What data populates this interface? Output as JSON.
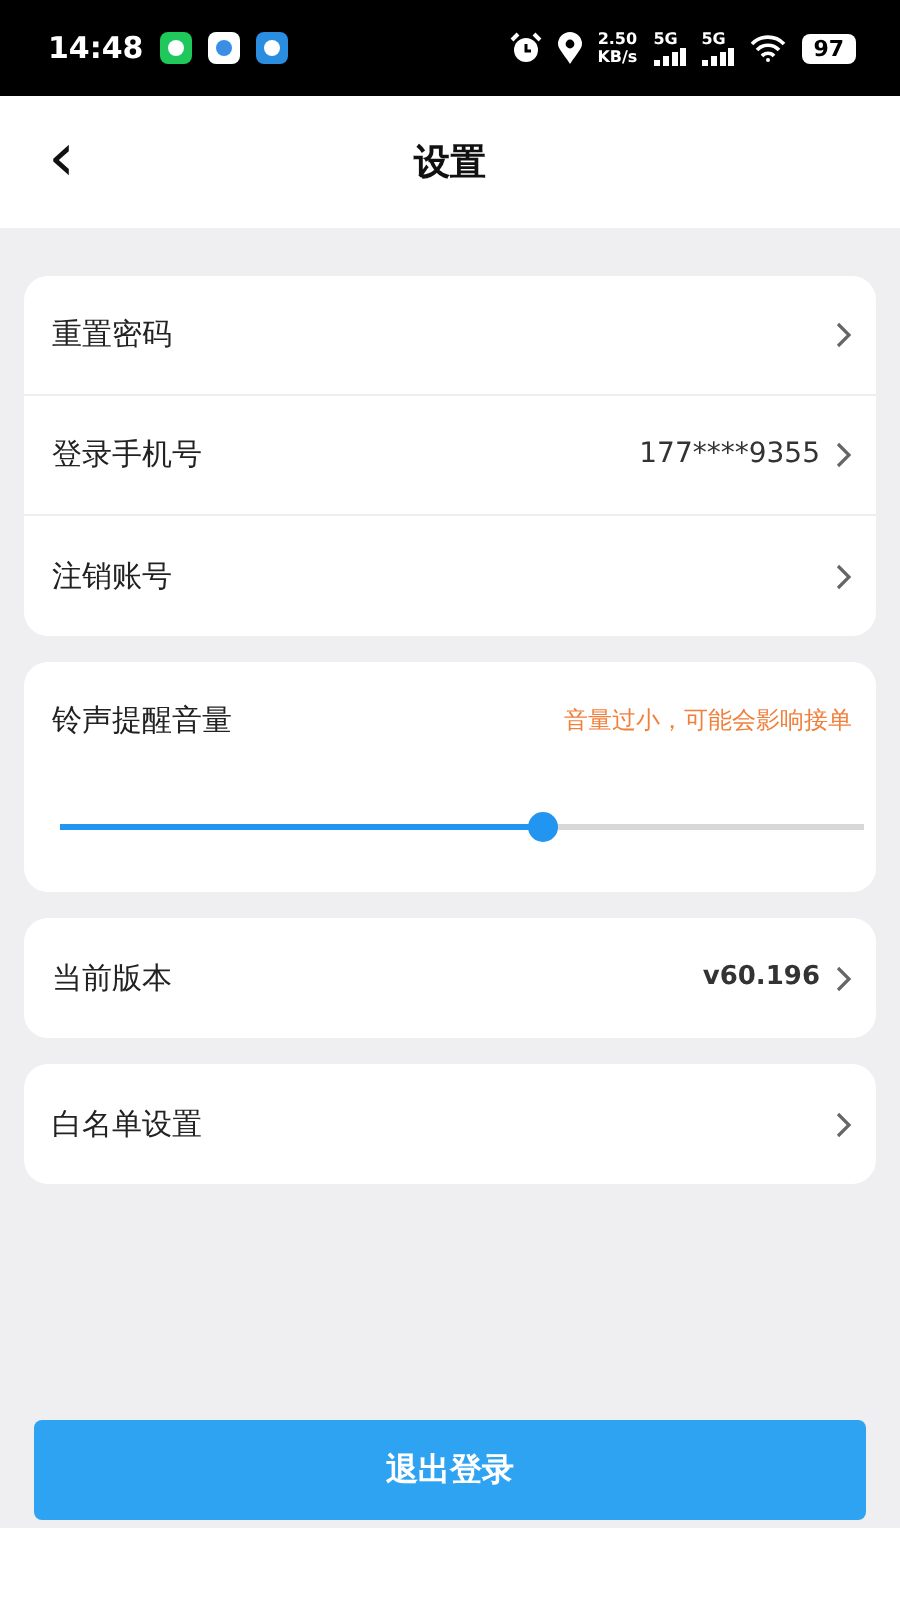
{
  "status_bar": {
    "time": "14:48",
    "speed": "2.50",
    "speed_unit": "KB/s",
    "networks": [
      "5G",
      "5G"
    ],
    "battery": "97"
  },
  "header": {
    "back": "‹",
    "title": "设置"
  },
  "account_items": [
    {
      "label": "重置密码",
      "value": ""
    },
    {
      "label": "登录手机号",
      "value": "177****9355"
    },
    {
      "label": "注销账号",
      "value": ""
    }
  ],
  "ringtone": {
    "label": "铃声提醒音量",
    "warning": "音量过小，可能会影响接单",
    "level": 0.6
  },
  "version": {
    "label": "当前版本",
    "value": "v60.196"
  },
  "whitelist": {
    "label": "白名单设置"
  },
  "logout_button": "退出登录"
}
